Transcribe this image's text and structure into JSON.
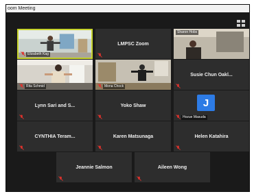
{
  "window": {
    "title": "oom Meeting"
  },
  "participants": [
    {
      "name": "Elizabeth Kag",
      "video": true,
      "active": true
    },
    {
      "name": "LMPSC Zoom",
      "video": false
    },
    {
      "name": "Sharon Hobs",
      "video": true
    },
    {
      "name": "Rita Schmid",
      "video": true
    },
    {
      "name": "Mona Chock",
      "video": true
    },
    {
      "name": "Susie Chun Oakl...",
      "video": false
    },
    {
      "name": "Lynn Sari and S...",
      "video": false
    },
    {
      "name": "Yoko Shaw",
      "video": false
    },
    {
      "name": "Hozue Masuda",
      "video": false,
      "avatar_letter": "J",
      "avatar_color": "#2d7be5"
    },
    {
      "name": "CYNTHIA Teram...",
      "video": false
    },
    {
      "name": "Karen Matsunaga",
      "video": false
    },
    {
      "name": "Helen Katahira",
      "video": false
    },
    {
      "name": "Jeannie Salmon",
      "video": false
    },
    {
      "name": "Aileen Wong",
      "video": false
    }
  ],
  "colors": {
    "active_speaker_border": "#c7d42c",
    "muted_icon": "#e0322d",
    "tile_bg": "#2d2d2d",
    "window_bg": "#1a1a1a"
  }
}
